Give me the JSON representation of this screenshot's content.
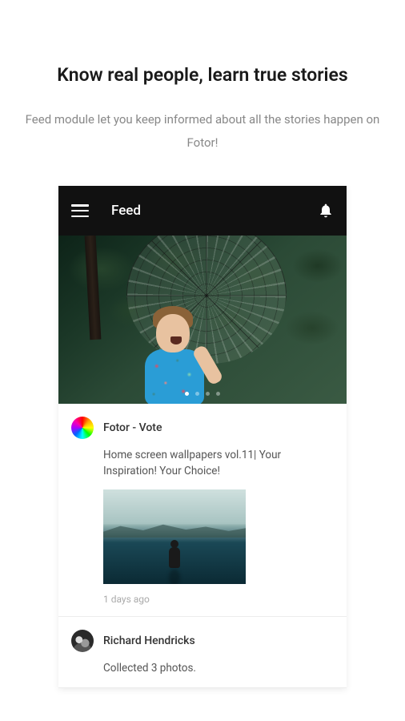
{
  "marketing": {
    "headline": "Know real people, learn true stories",
    "subhead": "Feed module let you keep informed about all the stories happen on Fotor!"
  },
  "app": {
    "title": "Feed",
    "carousel": {
      "dots": 4,
      "active": 0
    }
  },
  "feed": [
    {
      "author": "Fotor - Vote",
      "text": "Home screen wallpapers vol.11| Your Inspiration! Your Choice!",
      "time": "1 days ago",
      "avatar": "color-wheel",
      "has_thumb": true
    },
    {
      "author": "Richard Hendricks",
      "text": "Collected 3 photos.",
      "avatar": "bw-photo",
      "has_thumb": false
    }
  ]
}
